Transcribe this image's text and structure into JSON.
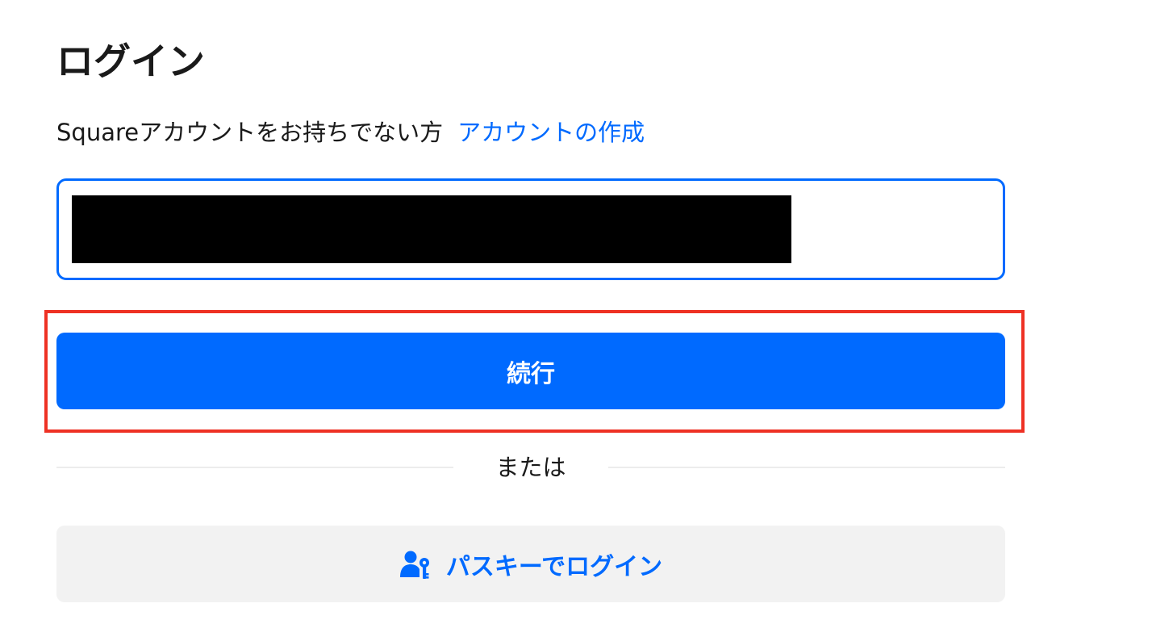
{
  "page": {
    "title": "ログイン"
  },
  "signup": {
    "prompt": "Squareアカウントをお持ちでない方",
    "link_label": "アカウントの作成"
  },
  "email": {
    "value": "",
    "redacted": true
  },
  "continue_button": {
    "label": "続行"
  },
  "divider": {
    "label": "または"
  },
  "passkey_button": {
    "icon": "user-key-icon",
    "label": "パスキーでログイン"
  },
  "colors": {
    "accent": "#006aff",
    "highlight": "#ee3124",
    "secondary_button_bg": "#f2f2f2",
    "text": "#1a1a1a"
  }
}
